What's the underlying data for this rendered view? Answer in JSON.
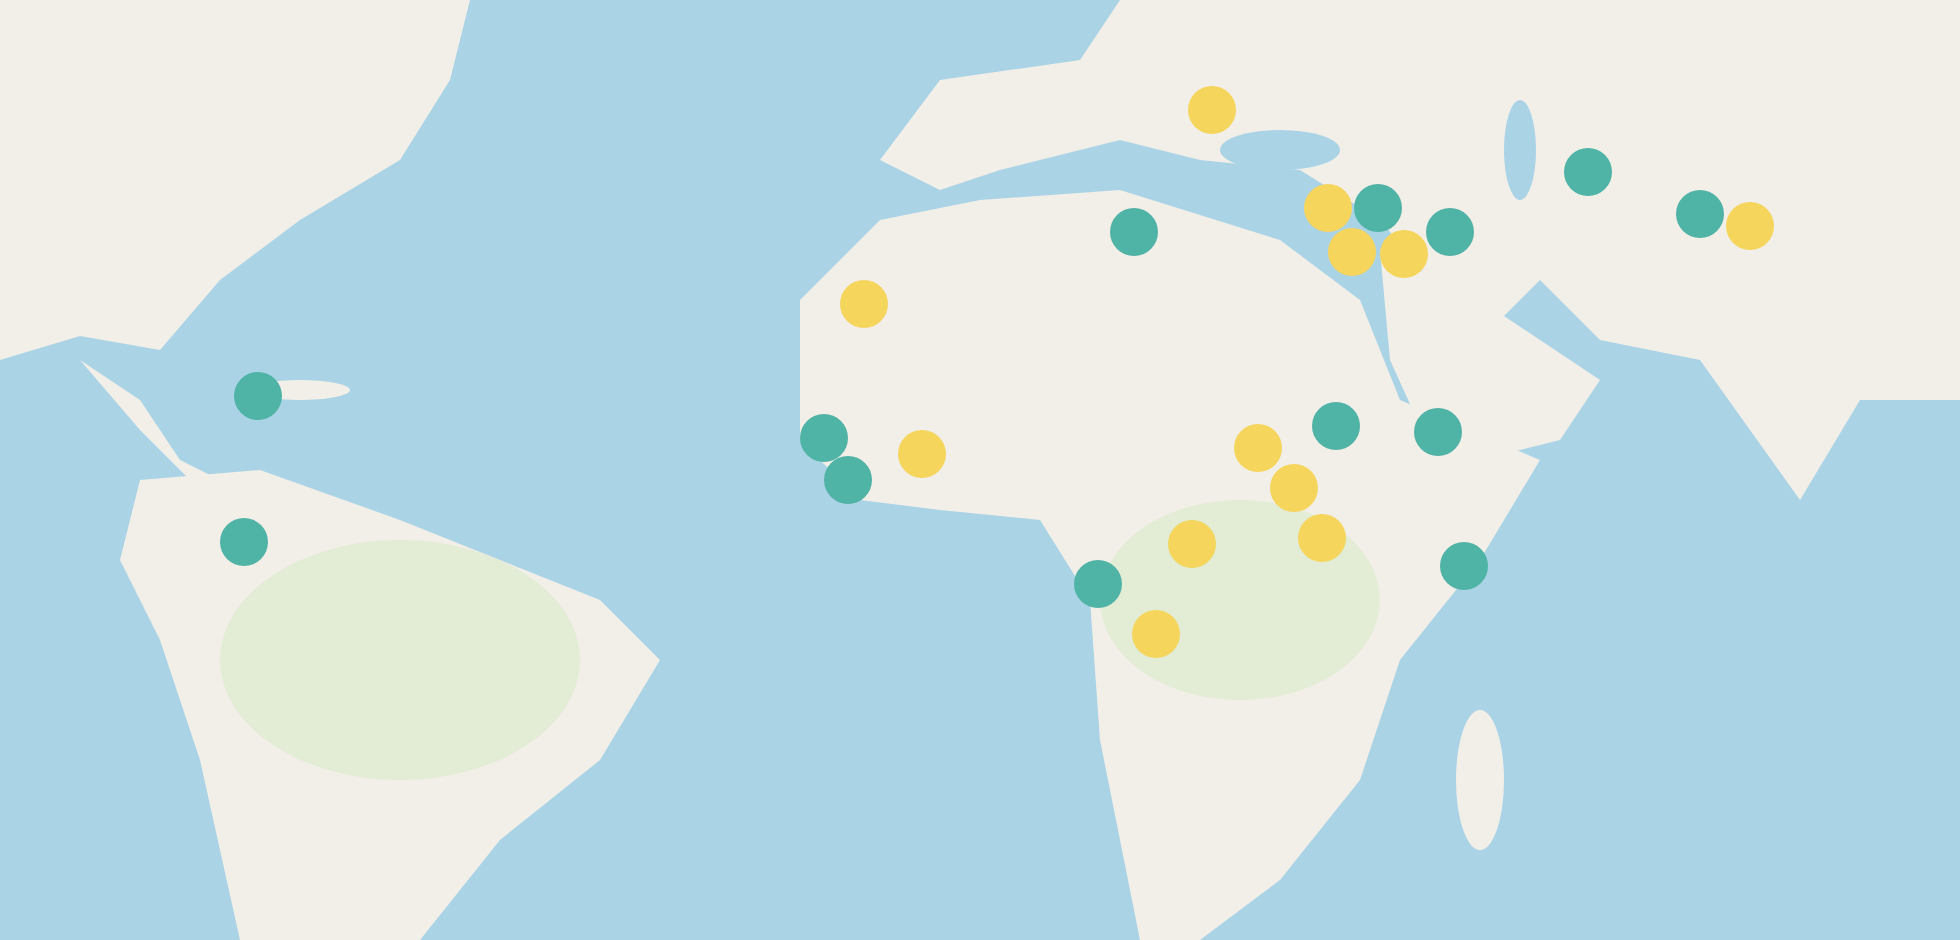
{
  "markers": [
    {
      "color": "#f5d55c"
    },
    {
      "color": "#4fb3a5"
    },
    {
      "color": "#f5d55c"
    },
    {
      "color": "#4fb3a5"
    },
    {
      "color": "#f5d55c"
    },
    {
      "color": "#f5d55c"
    },
    {
      "color": "#4fb3a5"
    },
    {
      "color": "#4fb3a5"
    },
    {
      "color": "#f5d55c"
    },
    {
      "color": "#4fb3a5"
    },
    {
      "color": "#f5d55c"
    },
    {
      "color": "#4fb3a5"
    },
    {
      "color": "#4fb3a5"
    },
    {
      "color": "#4fb3a5"
    },
    {
      "color": "#f5d55c"
    },
    {
      "color": "#f5d55c"
    },
    {
      "color": "#4fb3a5"
    },
    {
      "color": "#4fb3a5"
    },
    {
      "color": "#f5d55c"
    },
    {
      "color": "#f5d55c"
    },
    {
      "color": "#f5d55c"
    },
    {
      "color": "#4fb3a5"
    },
    {
      "color": "#4fb3a5"
    },
    {
      "color": "#4fb3a5"
    },
    {
      "color": "#f5d55c"
    }
  ]
}
